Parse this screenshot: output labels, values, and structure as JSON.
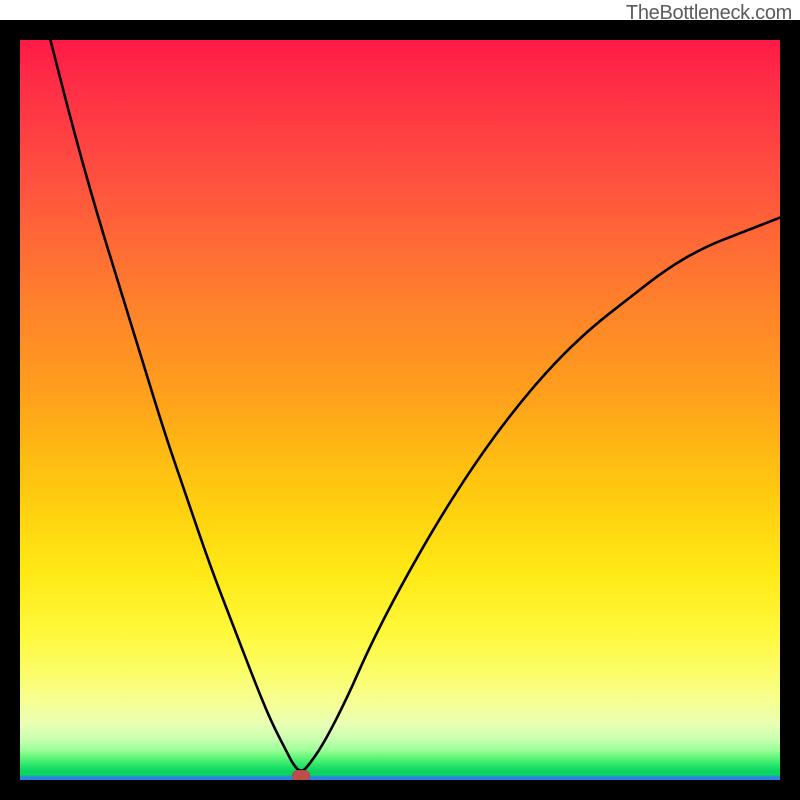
{
  "watermark": "TheBottleneck.com",
  "colors": {
    "frame_border": "#000000",
    "curve_stroke": "#000000",
    "marker_fill": "#bf4d4a",
    "gradient_top": "#ff1a46",
    "gradient_bottom_green": "#0bd45f",
    "gradient_bottom_blue": "#2a86e0"
  },
  "chart_data": {
    "type": "line",
    "title": "",
    "xlabel": "",
    "ylabel": "",
    "xlim": [
      0,
      100
    ],
    "ylim": [
      0,
      100
    ],
    "x": [
      4,
      7,
      10,
      13,
      16,
      19,
      22,
      25,
      28,
      31,
      33,
      35,
      36,
      37,
      38,
      40,
      43,
      46,
      50,
      55,
      60,
      65,
      70,
      75,
      80,
      85,
      90,
      95,
      100
    ],
    "y": [
      100,
      88,
      77,
      67,
      57,
      47,
      38,
      29,
      21,
      13,
      8,
      4,
      2,
      1,
      2,
      5,
      11,
      18,
      26,
      35,
      43,
      50,
      56,
      61,
      65,
      69,
      72,
      74,
      76
    ],
    "marker": {
      "x": 37,
      "y": 0.5
    },
    "notes": "Values read from pixel positions relative to inner plot area; x and y are percentages (0=left/bottom, 100=right/top). Minimum of the V-shaped curve at x≈37."
  }
}
